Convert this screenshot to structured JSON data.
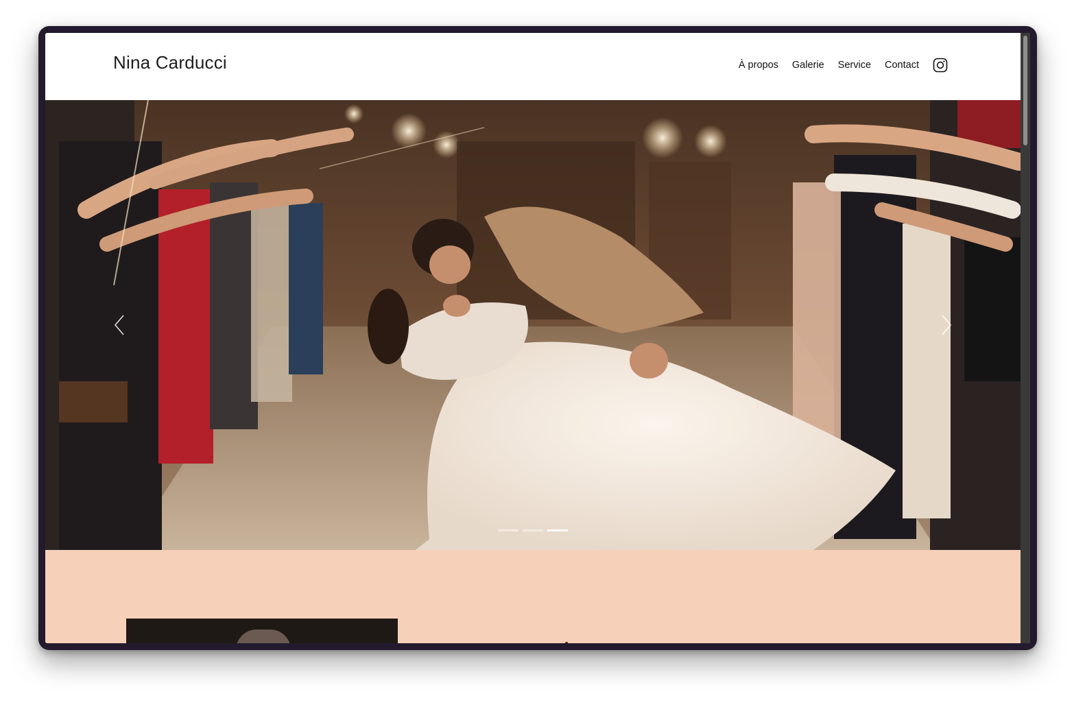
{
  "site": {
    "brand": "Nina Carducci"
  },
  "nav": {
    "items": [
      {
        "label": "À propos"
      },
      {
        "label": "Galerie"
      },
      {
        "label": "Service"
      },
      {
        "label": "Contact"
      }
    ],
    "instagram_icon": "instagram-icon"
  },
  "hero": {
    "image_icon": "photo",
    "carousel": {
      "slides": 3,
      "active_index": 2
    },
    "prev_icon": "chevron-left-icon",
    "next_icon": "chevron-right-icon"
  },
  "about": {
    "background_color": "#f6d0b8"
  },
  "colors": {
    "text": "#111111",
    "accent_peach": "#f6d0b8",
    "device_frame": "#231a2e"
  }
}
